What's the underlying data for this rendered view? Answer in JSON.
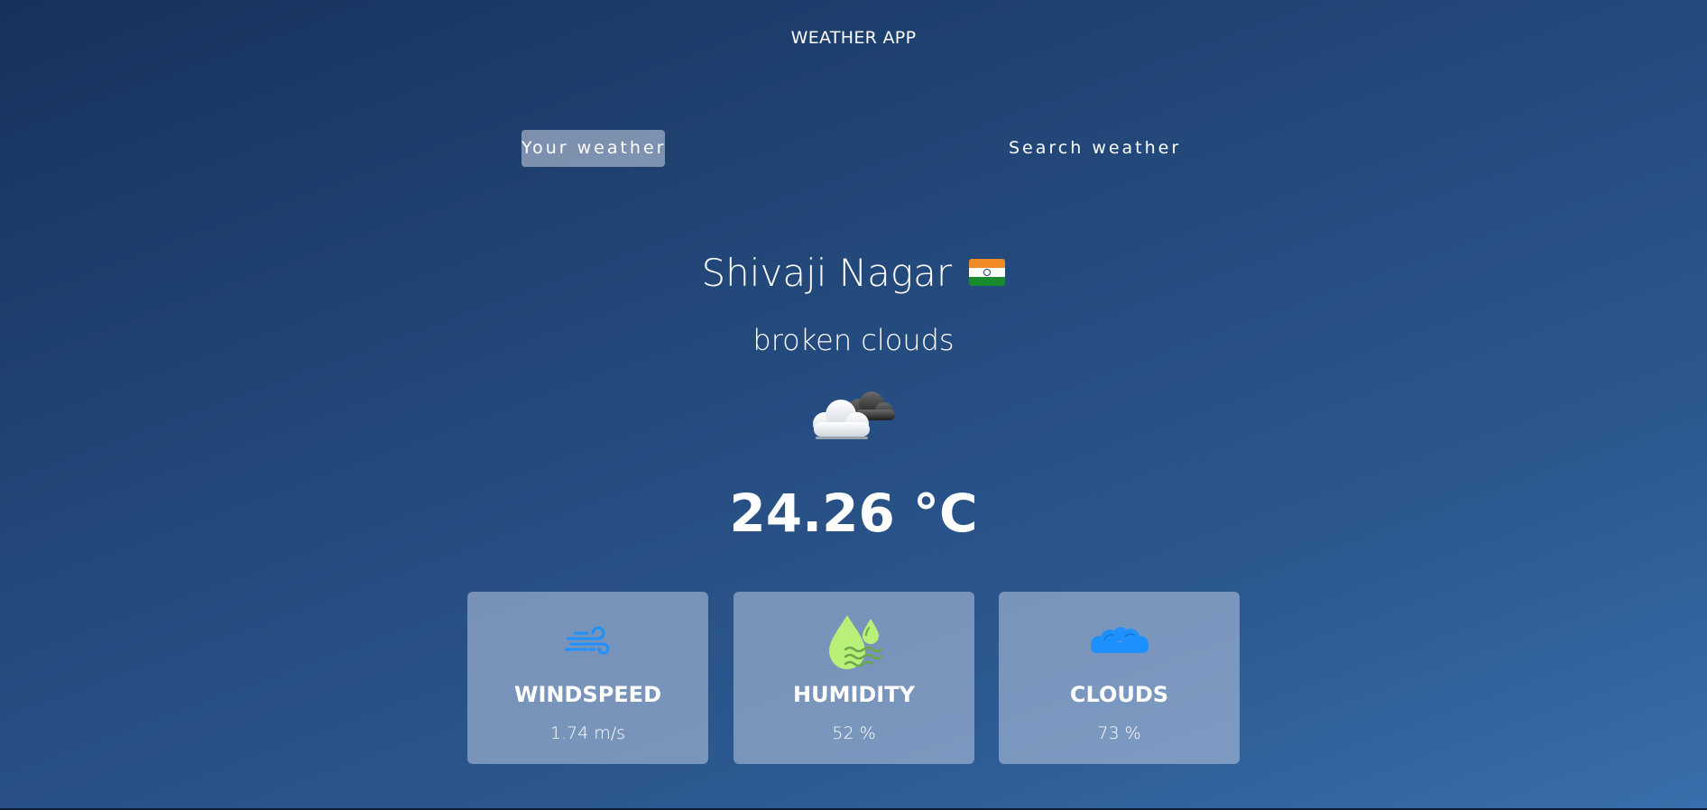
{
  "header": {
    "title": "WEATHER APP"
  },
  "tabs": {
    "your_weather": "Your weather",
    "search_weather": "Search weather"
  },
  "location": {
    "city": "Shivaji Nagar",
    "flag_icon": "india-flag-icon"
  },
  "weather": {
    "description": "broken clouds",
    "icon": "broken-clouds-icon",
    "temperature": "24.26 °C"
  },
  "stats": {
    "windspeed": {
      "label": "WINDSPEED",
      "value": "1.74 m/s",
      "icon": "wind-icon"
    },
    "humidity": {
      "label": "HUMIDITY",
      "value": "52 %",
      "icon": "humidity-drops-icon"
    },
    "clouds": {
      "label": "CLOUDS",
      "value": "73 %",
      "icon": "cloud-icon"
    }
  },
  "colors": {
    "accent_blue": "#1e90ff",
    "humidity_green": "#b8f07a"
  }
}
